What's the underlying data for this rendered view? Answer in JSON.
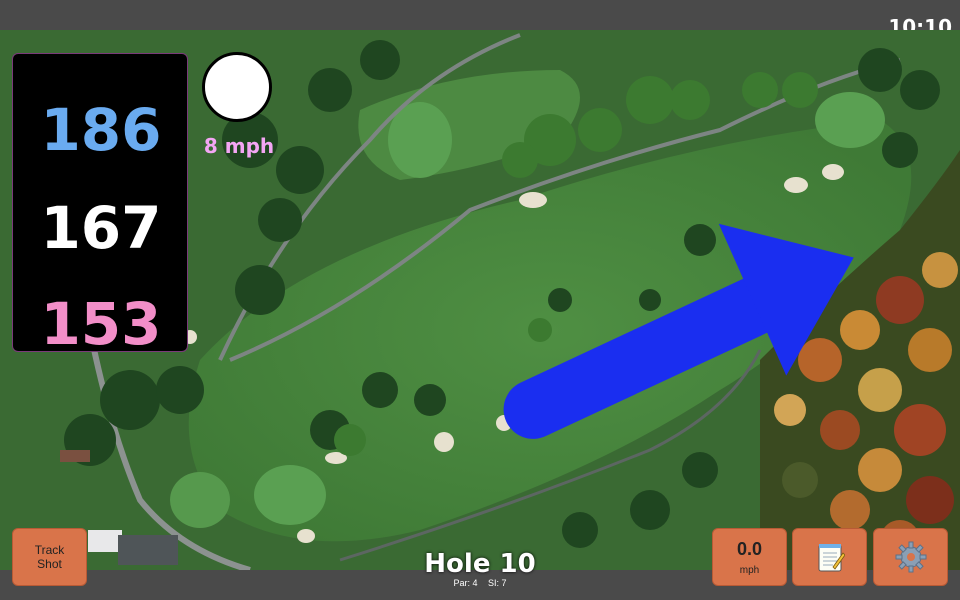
{
  "status_bar": {
    "time": "10:10"
  },
  "distances": {
    "back": "186",
    "middle": "167",
    "front": "153"
  },
  "wind": {
    "speed_label": "8 mph",
    "arrow_icon": "wind-arrow-icon"
  },
  "hole": {
    "title": "Hole 10",
    "par_label": "Par: 4",
    "si_label": "SI: 7"
  },
  "controls": {
    "track_shot_line1": "Track",
    "track_shot_line2": "Shot",
    "speed_value": "0.0",
    "speed_unit": "mph",
    "notes_icon": "notepad-icon",
    "settings_icon": "gear-icon"
  },
  "colors": {
    "back_distance": "#6aabf0",
    "middle_distance": "#ffffff",
    "front_distance": "#f28ec8",
    "wind_text": "#f4a6f4",
    "button_bg": "#d9744a"
  }
}
